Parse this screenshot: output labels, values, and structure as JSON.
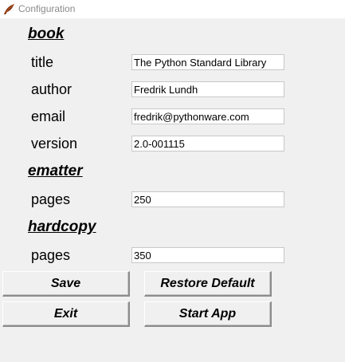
{
  "window": {
    "title": "Configuration",
    "icon": "feather-app-icon"
  },
  "sections": {
    "book": {
      "heading": "book",
      "fields": [
        {
          "label": "title",
          "value": "The Python Standard Library"
        },
        {
          "label": "author",
          "value": "Fredrik Lundh"
        },
        {
          "label": "email",
          "value": "fredrik@pythonware.com"
        },
        {
          "label": "version",
          "value": "2.0-001115"
        }
      ]
    },
    "ematter": {
      "heading": "ematter",
      "fields": [
        {
          "label": "pages",
          "value": "250"
        }
      ]
    },
    "hardcopy": {
      "heading": "hardcopy",
      "fields": [
        {
          "label": "pages",
          "value": "350"
        }
      ]
    }
  },
  "buttons": {
    "save": "Save",
    "restore_default": "Restore Default",
    "exit": "Exit",
    "start_app": "Start App"
  }
}
